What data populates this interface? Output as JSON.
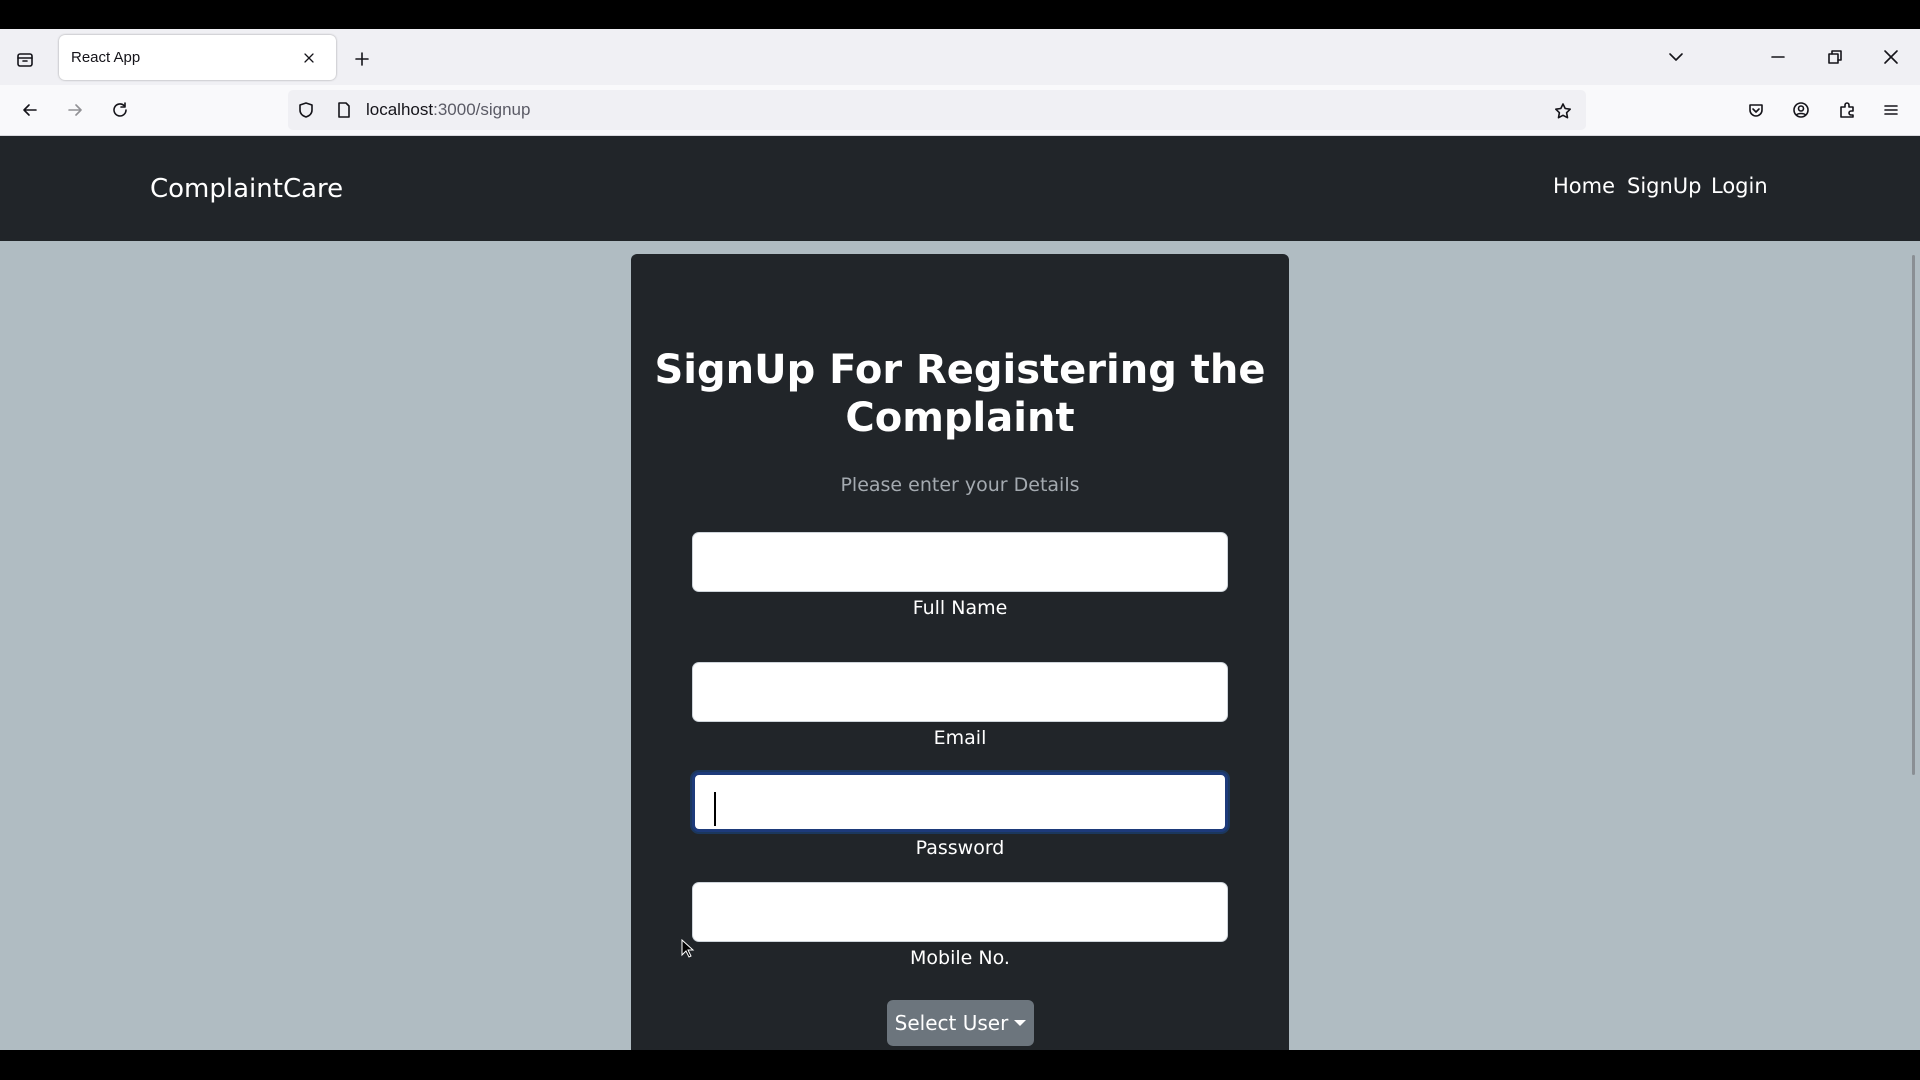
{
  "browser": {
    "tab_title": "React App",
    "url_host": "localhost",
    "url_path": ":3000/signup"
  },
  "navbar": {
    "brand": "ComplaintCare",
    "links": [
      "Home",
      "SignUp",
      "Login"
    ]
  },
  "form": {
    "heading": "SignUp For Registering the Complaint",
    "subtitle": "Please enter your Details",
    "fields": [
      {
        "label": "Full Name",
        "value": ""
      },
      {
        "label": "Email",
        "value": ""
      },
      {
        "label": "Password",
        "value": ""
      },
      {
        "label": "Mobile No.",
        "value": ""
      }
    ],
    "select_button": "Select User"
  },
  "colors": {
    "navbar_bg": "#212529",
    "page_bg": "#b0bcc2",
    "card_bg": "#212529",
    "select_button_bg": "#6c757d"
  }
}
